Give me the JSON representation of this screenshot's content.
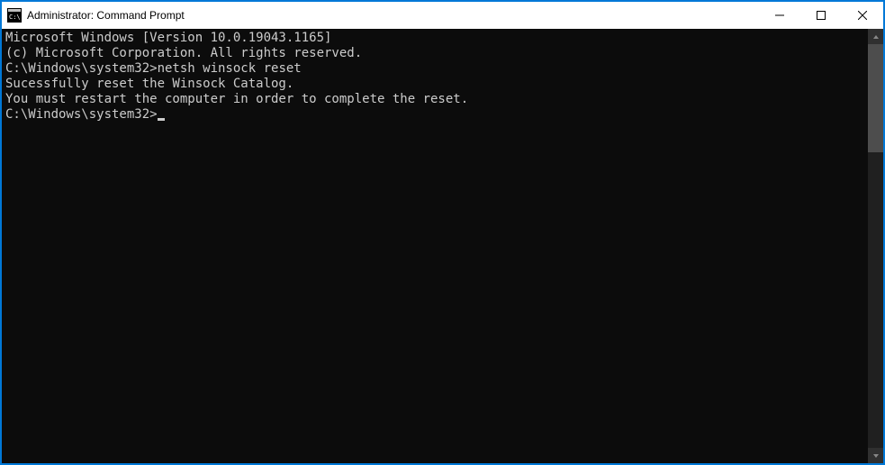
{
  "titlebar": {
    "title": "Administrator: Command Prompt"
  },
  "console": {
    "line1": "Microsoft Windows [Version 10.0.19043.1165]",
    "line2": "(c) Microsoft Corporation. All rights reserved.",
    "blank1": "",
    "prompt1": "C:\\Windows\\system32>",
    "command1": "netsh winsock reset",
    "blank2": "",
    "result1": "Sucessfully reset the Winsock Catalog.",
    "result2": "You must restart the computer in order to complete the reset.",
    "blank3": "",
    "blank4": "",
    "prompt2": "C:\\Windows\\system32>"
  }
}
